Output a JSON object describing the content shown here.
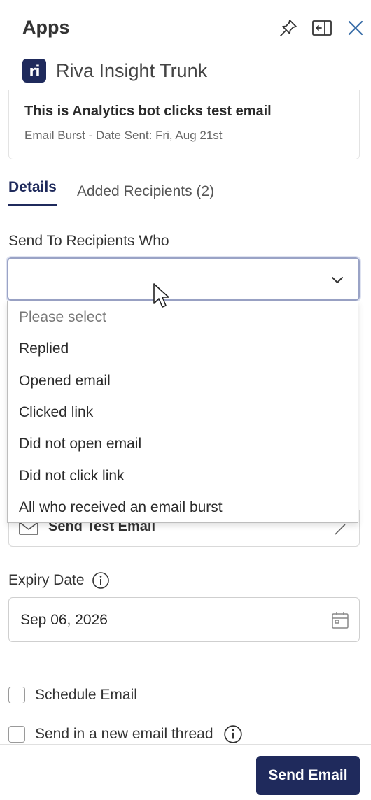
{
  "header": {
    "title": "Apps",
    "icons": [
      "pin-icon",
      "collapse-panel-icon",
      "close-icon"
    ]
  },
  "app": {
    "logo_text": "ri",
    "name": "Riva Insight Trunk"
  },
  "email_card": {
    "title": "This is Analytics bot clicks test email",
    "subtitle": "Email Burst - Date Sent: Fri, Aug 21st"
  },
  "tabs": [
    {
      "label": "Details",
      "active": true
    },
    {
      "label": "Added Recipients (2)",
      "active": false
    }
  ],
  "send_to": {
    "label": "Send To Recipients Who",
    "value": "",
    "options": [
      "Please select",
      "Replied",
      "Opened email",
      "Clicked link",
      "Did not open email",
      "Did not click link",
      "All who received an email burst"
    ]
  },
  "send_test_email": {
    "label": "Send Test Email"
  },
  "expiry": {
    "label": "Expiry Date",
    "value": "Sep 06, 2026"
  },
  "schedule_email": {
    "label": "Schedule Email",
    "checked": false
  },
  "new_thread": {
    "label": "Send in a new email thread",
    "checked": false
  },
  "footer": {
    "send_label": "Send Email"
  },
  "colors": {
    "brand": "#1f2a5c",
    "focus_border": "#9aa3c6"
  }
}
